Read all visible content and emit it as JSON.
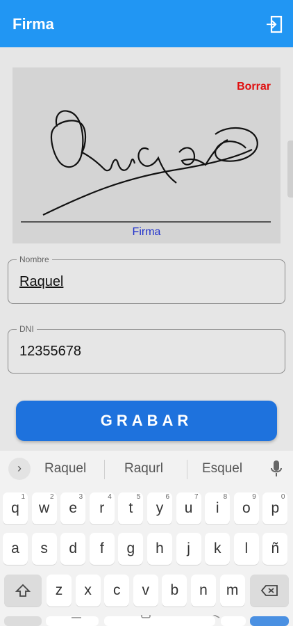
{
  "appbar": {
    "title": "Firma",
    "exit_icon": "exit-to-app-icon"
  },
  "signature": {
    "clear_label": "Borrar",
    "caption": "Firma"
  },
  "form": {
    "nombre": {
      "label": "Nombre",
      "value": "Raquel"
    },
    "dni": {
      "label": "DNI",
      "value": "12355678"
    }
  },
  "submit_label": "GRABAR",
  "keyboard": {
    "suggestions": [
      "Raquel",
      "Raqurl",
      "Esquel"
    ],
    "row1": [
      {
        "k": "q",
        "n": "1"
      },
      {
        "k": "w",
        "n": "2"
      },
      {
        "k": "e",
        "n": "3"
      },
      {
        "k": "r",
        "n": "4"
      },
      {
        "k": "t",
        "n": "5"
      },
      {
        "k": "y",
        "n": "6"
      },
      {
        "k": "u",
        "n": "7"
      },
      {
        "k": "i",
        "n": "8"
      },
      {
        "k": "o",
        "n": "9"
      },
      {
        "k": "p",
        "n": "0"
      }
    ],
    "row2": [
      "a",
      "s",
      "d",
      "f",
      "g",
      "h",
      "j",
      "k",
      "l",
      "ñ"
    ],
    "row3": [
      "z",
      "x",
      "c",
      "v",
      "b",
      "n",
      "m"
    ]
  },
  "colors": {
    "appbar": "#2196f3",
    "button": "#1e72dd",
    "clear": "#e01010",
    "caption": "#2233cc"
  }
}
